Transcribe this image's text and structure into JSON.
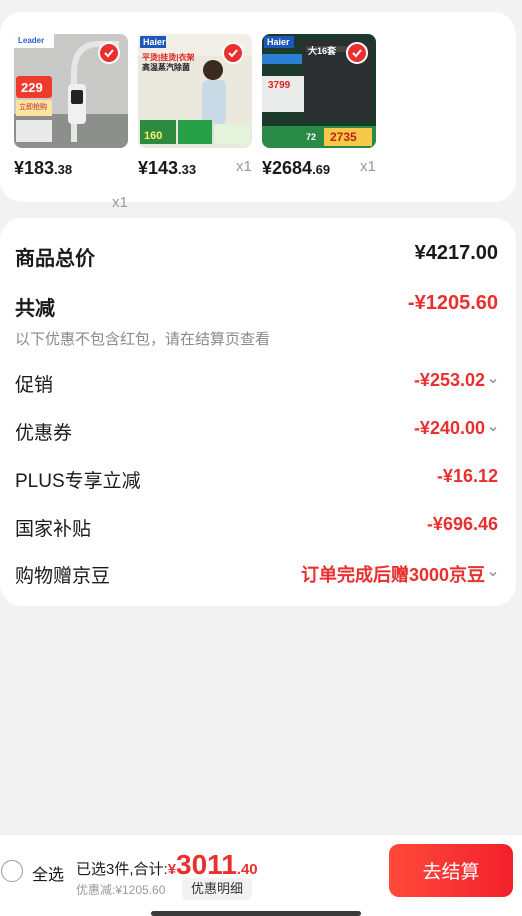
{
  "products": [
    {
      "brand": "Leader",
      "price_int": "¥183",
      "price_dec": ".38",
      "qty": "x1",
      "image_text": [
        "229",
        "立即抢购"
      ],
      "bg": "#c7c7c5"
    },
    {
      "brand": "Haier",
      "price_int": "¥143",
      "price_dec": ".33",
      "qty": "x1",
      "image_text": [
        "平烫|挂烫|衣架",
        "高温蒸汽除菌",
        "160"
      ],
      "bg": "#e9e6dc"
    },
    {
      "brand": "Haier",
      "price_int": "¥2684",
      "price_dec": ".69",
      "qty": "x1",
      "image_text": [
        "大16套",
        "3799",
        "2735",
        "72"
      ],
      "bg": "#1f3b2e"
    }
  ],
  "summary": {
    "goods_total_label": "商品总价",
    "goods_total_value": "¥4217.00",
    "total_reduce_label": "共减",
    "total_reduce_value": "-¥1205.60",
    "note": "以下优惠不包含红包，请在结算页查看",
    "rows": [
      {
        "label": "促销",
        "value": "-¥253.02",
        "chevron": true
      },
      {
        "label": "优惠券",
        "value": "-¥240.00",
        "chevron": true
      },
      {
        "label": "PLUS专享立减",
        "value": "-¥16.12",
        "chevron": false
      },
      {
        "label": "国家补贴",
        "value": "-¥696.46",
        "chevron": false
      },
      {
        "label": "购物赠京豆",
        "value": "订单完成后赠3000京豆",
        "chevron": true
      }
    ]
  },
  "bottom": {
    "select_all": "全选",
    "selected_text": "已选3件,合计:",
    "yen": "¥",
    "total_int": "3011",
    "total_dec": ".40",
    "discount_text": "优惠减:¥1205.60",
    "detail_button": "优惠明细",
    "checkout_button": "去结算"
  },
  "colors": {
    "accent_red": "#e9302e",
    "page_bg": "#f2f2f2"
  }
}
